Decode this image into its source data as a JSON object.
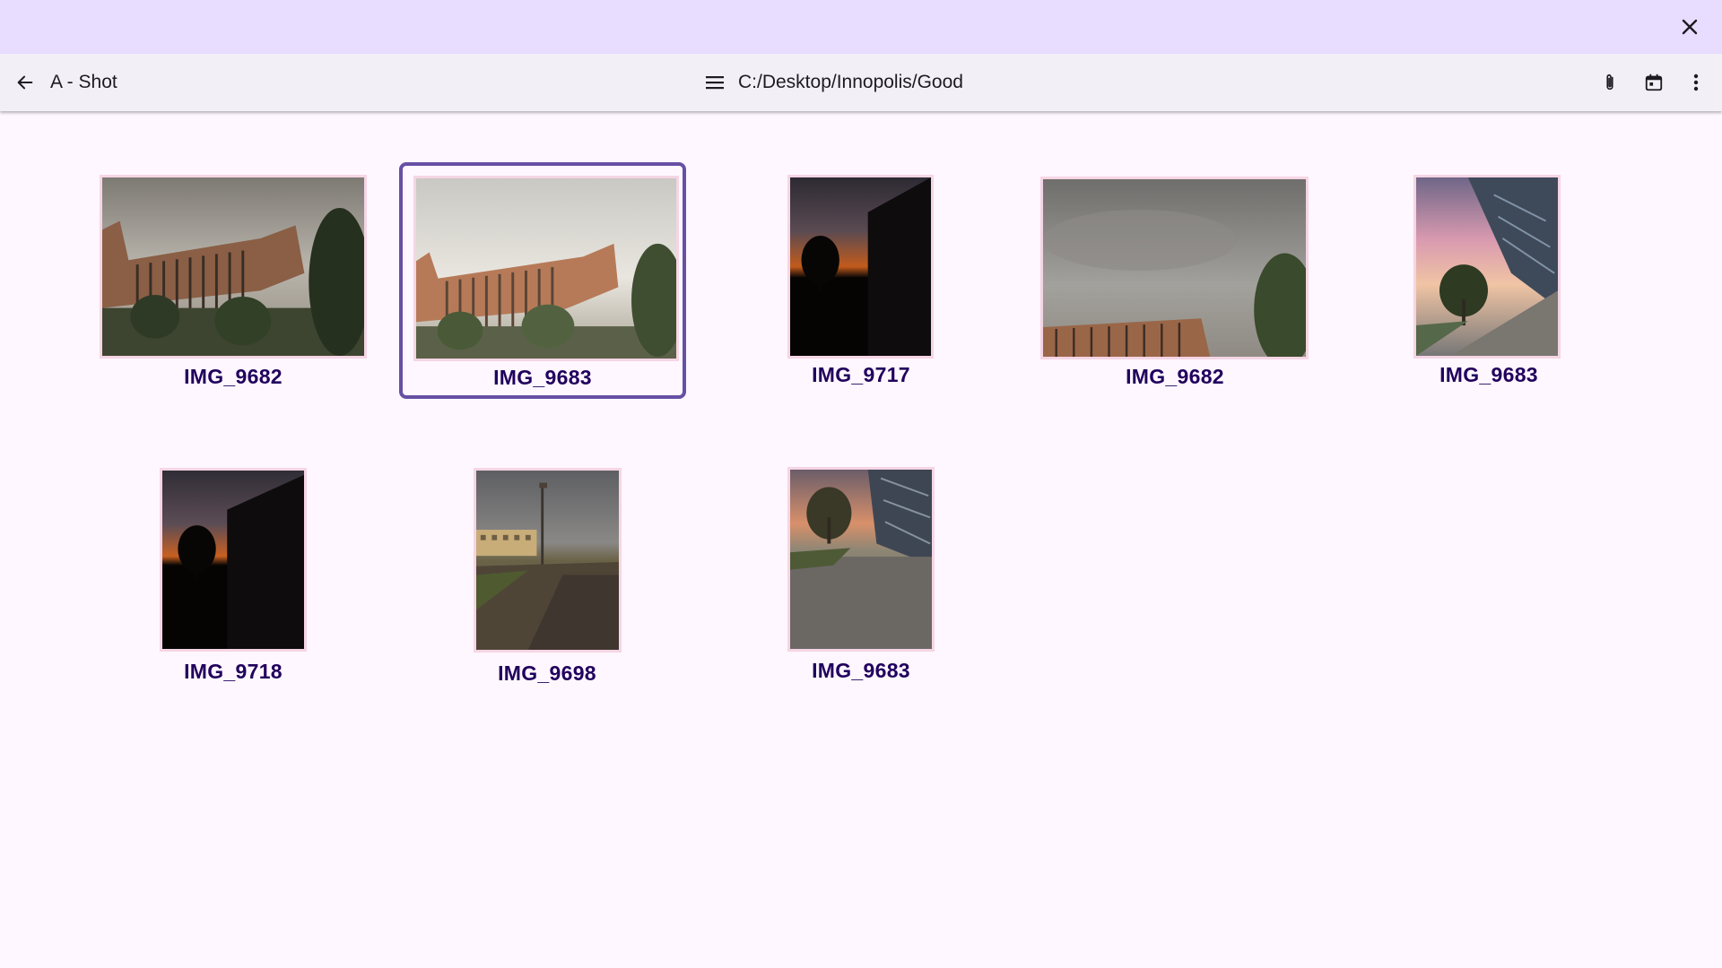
{
  "window": {
    "close_icon": "close-icon"
  },
  "toolbar": {
    "back_icon": "arrow-left-icon",
    "title": "A - Shot",
    "menu_icon": "hamburger-menu-icon",
    "path": "C:/Desktop/Innopolis/Good",
    "attach_icon": "paperclip-icon",
    "calendar_icon": "calendar-icon",
    "more_icon": "more-vertical-icon"
  },
  "colors": {
    "titlebar": "#e9ddff",
    "toolbar": "#f3eff7",
    "background": "#fef7ff",
    "selection": "#6750a4",
    "caption": "#21005d",
    "thumb_border": "#f5d5e4"
  },
  "gallery": {
    "items": [
      {
        "name": "IMG_9682",
        "selected": false,
        "scene": "building-overcast"
      },
      {
        "name": "IMG_9683",
        "selected": true,
        "scene": "building-bright"
      },
      {
        "name": "IMG_9717",
        "selected": false,
        "scene": "dark-sunset-tree"
      },
      {
        "name": "IMG_9682",
        "selected": false,
        "scene": "cloudy-sky-roof"
      },
      {
        "name": "IMG_9683",
        "selected": false,
        "scene": "glass-building-sunset"
      },
      {
        "name": "IMG_9718",
        "selected": false,
        "scene": "dark-sunset-tree"
      },
      {
        "name": "IMG_9698",
        "selected": false,
        "scene": "lamp-post-street"
      },
      {
        "name": "IMG_9683",
        "selected": false,
        "scene": "glass-building-pavement"
      }
    ]
  }
}
